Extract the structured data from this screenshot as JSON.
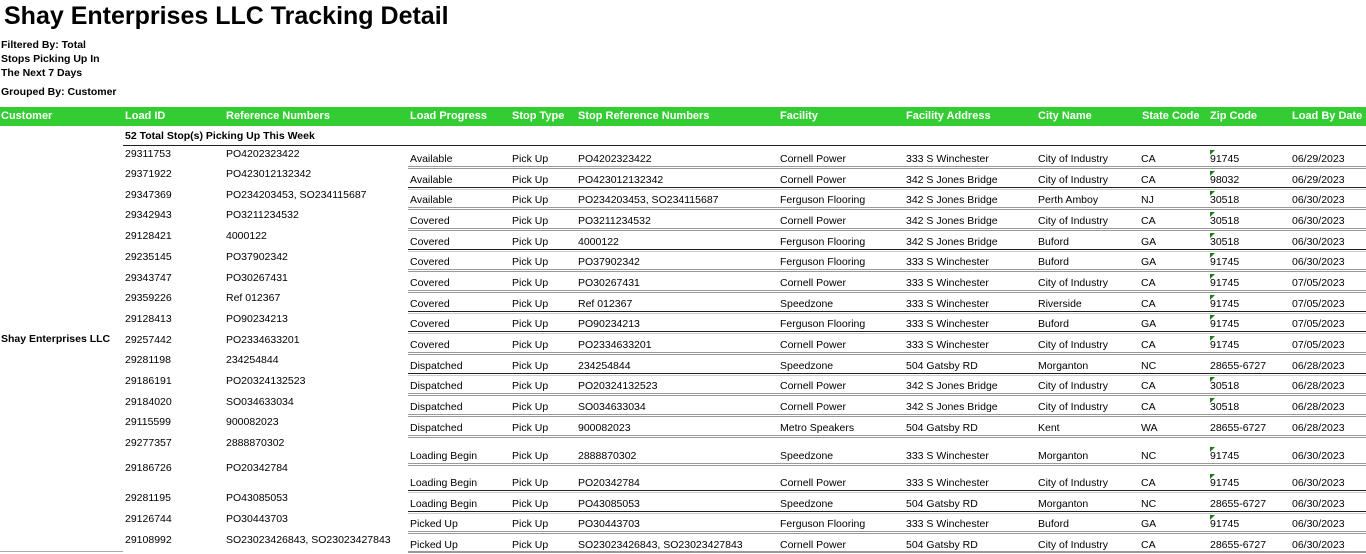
{
  "title": "Shay Enterprises LLC Tracking Detail",
  "filter": {
    "lines": [
      "Filtered By: Total",
      "Stops Picking Up In",
      "The Next 7 Days"
    ]
  },
  "grouped_by": "Grouped By: Customer",
  "colors": {
    "header_bg": "#33cc33",
    "header_text": "#ffffff",
    "zip_indicator": "#1e7e1e"
  },
  "columns": {
    "customer": "Customer",
    "load_id": "Load ID",
    "reference_numbers": "Reference Numbers",
    "load_progress": "Load Progress",
    "stop_type": "Stop Type",
    "stop_reference_numbers": "Stop Reference Numbers",
    "facility": "Facility",
    "facility_address": "Facility Address",
    "city_name": "City Name",
    "state_code": "State Code",
    "zip_code": "Zip Code",
    "load_by_date": "Load By Date"
  },
  "summary": "52 Total Stop(s) Picking Up This Week",
  "customer": "Shay Enterprises LLC",
  "rows": [
    {
      "load_id": "29311753",
      "ref": "PO4202323422",
      "progress": "Available",
      "stop_type": "Pick Up",
      "stop_ref": "PO4202323422",
      "facility": "Cornell Power",
      "address": "333 S Winchester",
      "city": "City of Industry",
      "state": "CA",
      "zip": "91745",
      "zip_text_flag": true,
      "date": "06/29/2023"
    },
    {
      "load_id": "29371922",
      "ref": "PO423012132342",
      "progress": "Available",
      "stop_type": "Pick Up",
      "stop_ref": "PO423012132342",
      "facility": "Cornell Power",
      "address": "342 S Jones Bridge",
      "city": "City of Industry",
      "state": "CA",
      "zip": "98032",
      "zip_text_flag": true,
      "date": "06/29/2023"
    },
    {
      "load_id": "29347369",
      "ref": "PO234203453, SO234115687",
      "progress": "Available",
      "stop_type": "Pick Up",
      "stop_ref": "PO234203453, SO234115687",
      "facility": "Ferguson Flooring",
      "address": "342 S Jones Bridge",
      "city": "Perth Amboy",
      "state": "NJ",
      "zip": "30518",
      "zip_text_flag": true,
      "date": "06/30/2023"
    },
    {
      "load_id": "29342943",
      "ref": "PO3211234532",
      "progress": "Covered",
      "stop_type": "Pick Up",
      "stop_ref": "PO3211234532",
      "facility": "Cornell Power",
      "address": "342 S Jones Bridge",
      "city": "City of Industry",
      "state": "CA",
      "zip": "30518",
      "zip_text_flag": true,
      "date": "06/30/2023"
    },
    {
      "load_id": "29128421",
      "ref": "4000122",
      "progress": "Covered",
      "stop_type": "Pick Up",
      "stop_ref": "4000122",
      "facility": "Ferguson Flooring",
      "address": "342 S Jones Bridge",
      "city": "Buford",
      "state": "GA",
      "zip": "30518",
      "zip_text_flag": true,
      "date": "06/30/2023"
    },
    {
      "load_id": "29235145",
      "ref": "PO37902342",
      "progress": "Covered",
      "stop_type": "Pick Up",
      "stop_ref": "PO37902342",
      "facility": "Ferguson Flooring",
      "address": "333 S Winchester",
      "city": "Buford",
      "state": "GA",
      "zip": "91745",
      "zip_text_flag": true,
      "date": "06/30/2023"
    },
    {
      "load_id": "29343747",
      "ref": "PO30267431",
      "progress": "Covered",
      "stop_type": "Pick Up",
      "stop_ref": "PO30267431",
      "facility": "Cornell Power",
      "address": "333 S Winchester",
      "city": "City of Industry",
      "state": "CA",
      "zip": "91745",
      "zip_text_flag": true,
      "date": "07/05/2023"
    },
    {
      "load_id": "29359226",
      "ref": "Ref 012367",
      "progress": "Covered",
      "stop_type": "Pick Up",
      "stop_ref": "Ref 012367",
      "facility": "Speedzone",
      "address": "333 S Winchester",
      "city": "Riverside",
      "state": "CA",
      "zip": "91745",
      "zip_text_flag": true,
      "date": "07/05/2023"
    },
    {
      "load_id": "29128413",
      "ref": "PO90234213",
      "progress": "Covered",
      "stop_type": "Pick Up",
      "stop_ref": "PO90234213",
      "facility": "Ferguson Flooring",
      "address": "333 S Winchester",
      "city": "Buford",
      "state": "GA",
      "zip": "91745",
      "zip_text_flag": true,
      "date": "07/05/2023"
    },
    {
      "load_id": "29257442",
      "ref": "PO2334633201",
      "progress": "Covered",
      "stop_type": "Pick Up",
      "stop_ref": "PO2334633201",
      "facility": "Cornell Power",
      "address": "333 S Winchester",
      "city": "City of Industry",
      "state": "CA",
      "zip": "91745",
      "zip_text_flag": true,
      "date": "07/05/2023"
    },
    {
      "load_id": "29281198",
      "ref": "234254844",
      "progress": "Dispatched",
      "stop_type": "Pick Up",
      "stop_ref": "234254844",
      "facility": "Speedzone",
      "address": "504 Gatsby RD",
      "city": "Morganton",
      "state": "NC",
      "zip": "28655-6727",
      "zip_text_flag": false,
      "date": "06/28/2023"
    },
    {
      "load_id": "29186191",
      "ref": "PO20324132523",
      "progress": "Dispatched",
      "stop_type": "Pick Up",
      "stop_ref": "PO20324132523",
      "facility": "Cornell Power",
      "address": "342 S Jones Bridge",
      "city": "City of Industry",
      "state": "CA",
      "zip": "30518",
      "zip_text_flag": true,
      "date": "06/28/2023"
    },
    {
      "load_id": "29184020",
      "ref": "SO034633034",
      "progress": "Dispatched",
      "stop_type": "Pick Up",
      "stop_ref": "SO034633034",
      "facility": "Cornell Power",
      "address": "342 S Jones Bridge",
      "city": "City of Industry",
      "state": "CA",
      "zip": "30518",
      "zip_text_flag": true,
      "date": "06/28/2023"
    },
    {
      "load_id": "29115599",
      "ref": "900082023",
      "progress": "Dispatched",
      "stop_type": "Pick Up",
      "stop_ref": "900082023",
      "facility": "Metro Speakers",
      "address": "504 Gatsby RD",
      "city": "Kent",
      "state": "WA",
      "zip": "28655-6727",
      "zip_text_flag": false,
      "date": "06/28/2023"
    },
    {
      "load_id": "29277357",
      "ref": "2888870302",
      "progress": "Loading Begin",
      "stop_type": "Pick Up",
      "stop_ref": "2888870302",
      "facility": "Speedzone",
      "address": "333 S Winchester",
      "city": "Morganton",
      "state": "NC",
      "zip": "91745",
      "zip_text_flag": true,
      "date": "06/30/2023"
    },
    {
      "load_id": "29186726",
      "ref": "PO20342784",
      "progress": "Loading Begin",
      "stop_type": "Pick Up",
      "stop_ref": "PO20342784",
      "facility": "Cornell Power",
      "address": "333 S Winchester",
      "city": "City of Industry",
      "state": "CA",
      "zip": "91745",
      "zip_text_flag": true,
      "date": "06/30/2023"
    },
    {
      "load_id": "29281195",
      "ref": "PO43085053",
      "progress": "Loading Begin",
      "stop_type": "Pick Up",
      "stop_ref": "PO43085053",
      "facility": "Speedzone",
      "address": "504 Gatsby RD",
      "city": "Morganton",
      "state": "NC",
      "zip": "28655-6727",
      "zip_text_flag": false,
      "date": "06/30/2023"
    },
    {
      "load_id": "29126744",
      "ref": "PO30443703",
      "progress": "Picked Up",
      "stop_type": "Pick Up",
      "stop_ref": "PO30443703",
      "facility": "Ferguson Flooring",
      "address": "333 S Winchester",
      "city": "Buford",
      "state": "GA",
      "zip": "91745",
      "zip_text_flag": true,
      "date": "06/30/2023"
    },
    {
      "load_id": "29108992",
      "ref": "SO23023426843, SO23023427843",
      "progress": "Picked Up",
      "stop_type": "Pick Up",
      "stop_ref": "SO23023426843, SO23023427843",
      "facility": "Cornell Power",
      "address": "504 Gatsby RD",
      "city": "City of Industry",
      "state": "CA",
      "zip": "28655-6727",
      "zip_text_flag": false,
      "date": "06/30/2023"
    }
  ]
}
